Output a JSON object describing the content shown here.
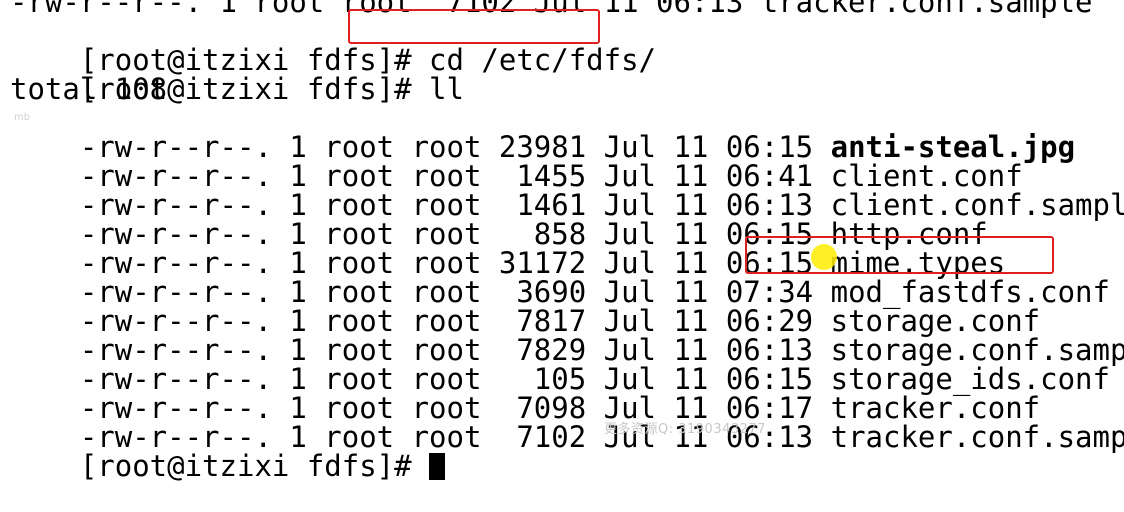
{
  "terminal": {
    "prompt": "[root@itzixi fdfs]# ",
    "clipped_top_line": "-rw-r--r--. 1 root root  7102 Jul 11 06:13 tracker.conf.sample",
    "command_cd": "cd /etc/fdfs/",
    "command_ll": "ll",
    "total_line": "total 108",
    "listing": [
      {
        "perms": "-rw-r--r--. 1 root root 23981 Jul 11 06:15 ",
        "name": "anti-steal.jpg"
      },
      {
        "perms": "-rw-r--r--. 1 root root  1455 Jul 11 06:41 ",
        "name": "client.conf"
      },
      {
        "perms": "-rw-r--r--. 1 root root  1461 Jul 11 06:13 ",
        "name": "client.conf.sample"
      },
      {
        "perms": "-rw-r--r--. 1 root root   858 Jul 11 06:15 ",
        "name": "http.conf"
      },
      {
        "perms": "-rw-r--r--. 1 root root 31172 Jul 11 06:15 ",
        "name": "mime.types"
      },
      {
        "perms": "-rw-r--r--. 1 root root  3690 Jul 11 07:34 ",
        "name": "mod_fastdfs.conf"
      },
      {
        "perms": "-rw-r--r--. 1 root root  7817 Jul 11 06:29 ",
        "name": "storage.conf"
      },
      {
        "perms": "-rw-r--r--. 1 root root  7829 Jul 11 06:13 ",
        "name": "storage.conf.sample"
      },
      {
        "perms": "-rw-r--r--. 1 root root   105 Jul 11 06:15 ",
        "name": "storage_ids.conf"
      },
      {
        "perms": "-rw-r--r--. 1 root root  7098 Jul 11 06:17 ",
        "name": "tracker.conf"
      },
      {
        "perms": "-rw-r--r--. 1 root root  7102 Jul 11 06:13 ",
        "name": "tracker.conf.sample"
      }
    ],
    "watermark_main": "更多资源Q: 3190343277",
    "watermark_small": "mb"
  },
  "colors": {
    "background": "#ffffff",
    "text": "#000000",
    "highlight_box": "#e02020",
    "pointer": "#ffec00"
  }
}
